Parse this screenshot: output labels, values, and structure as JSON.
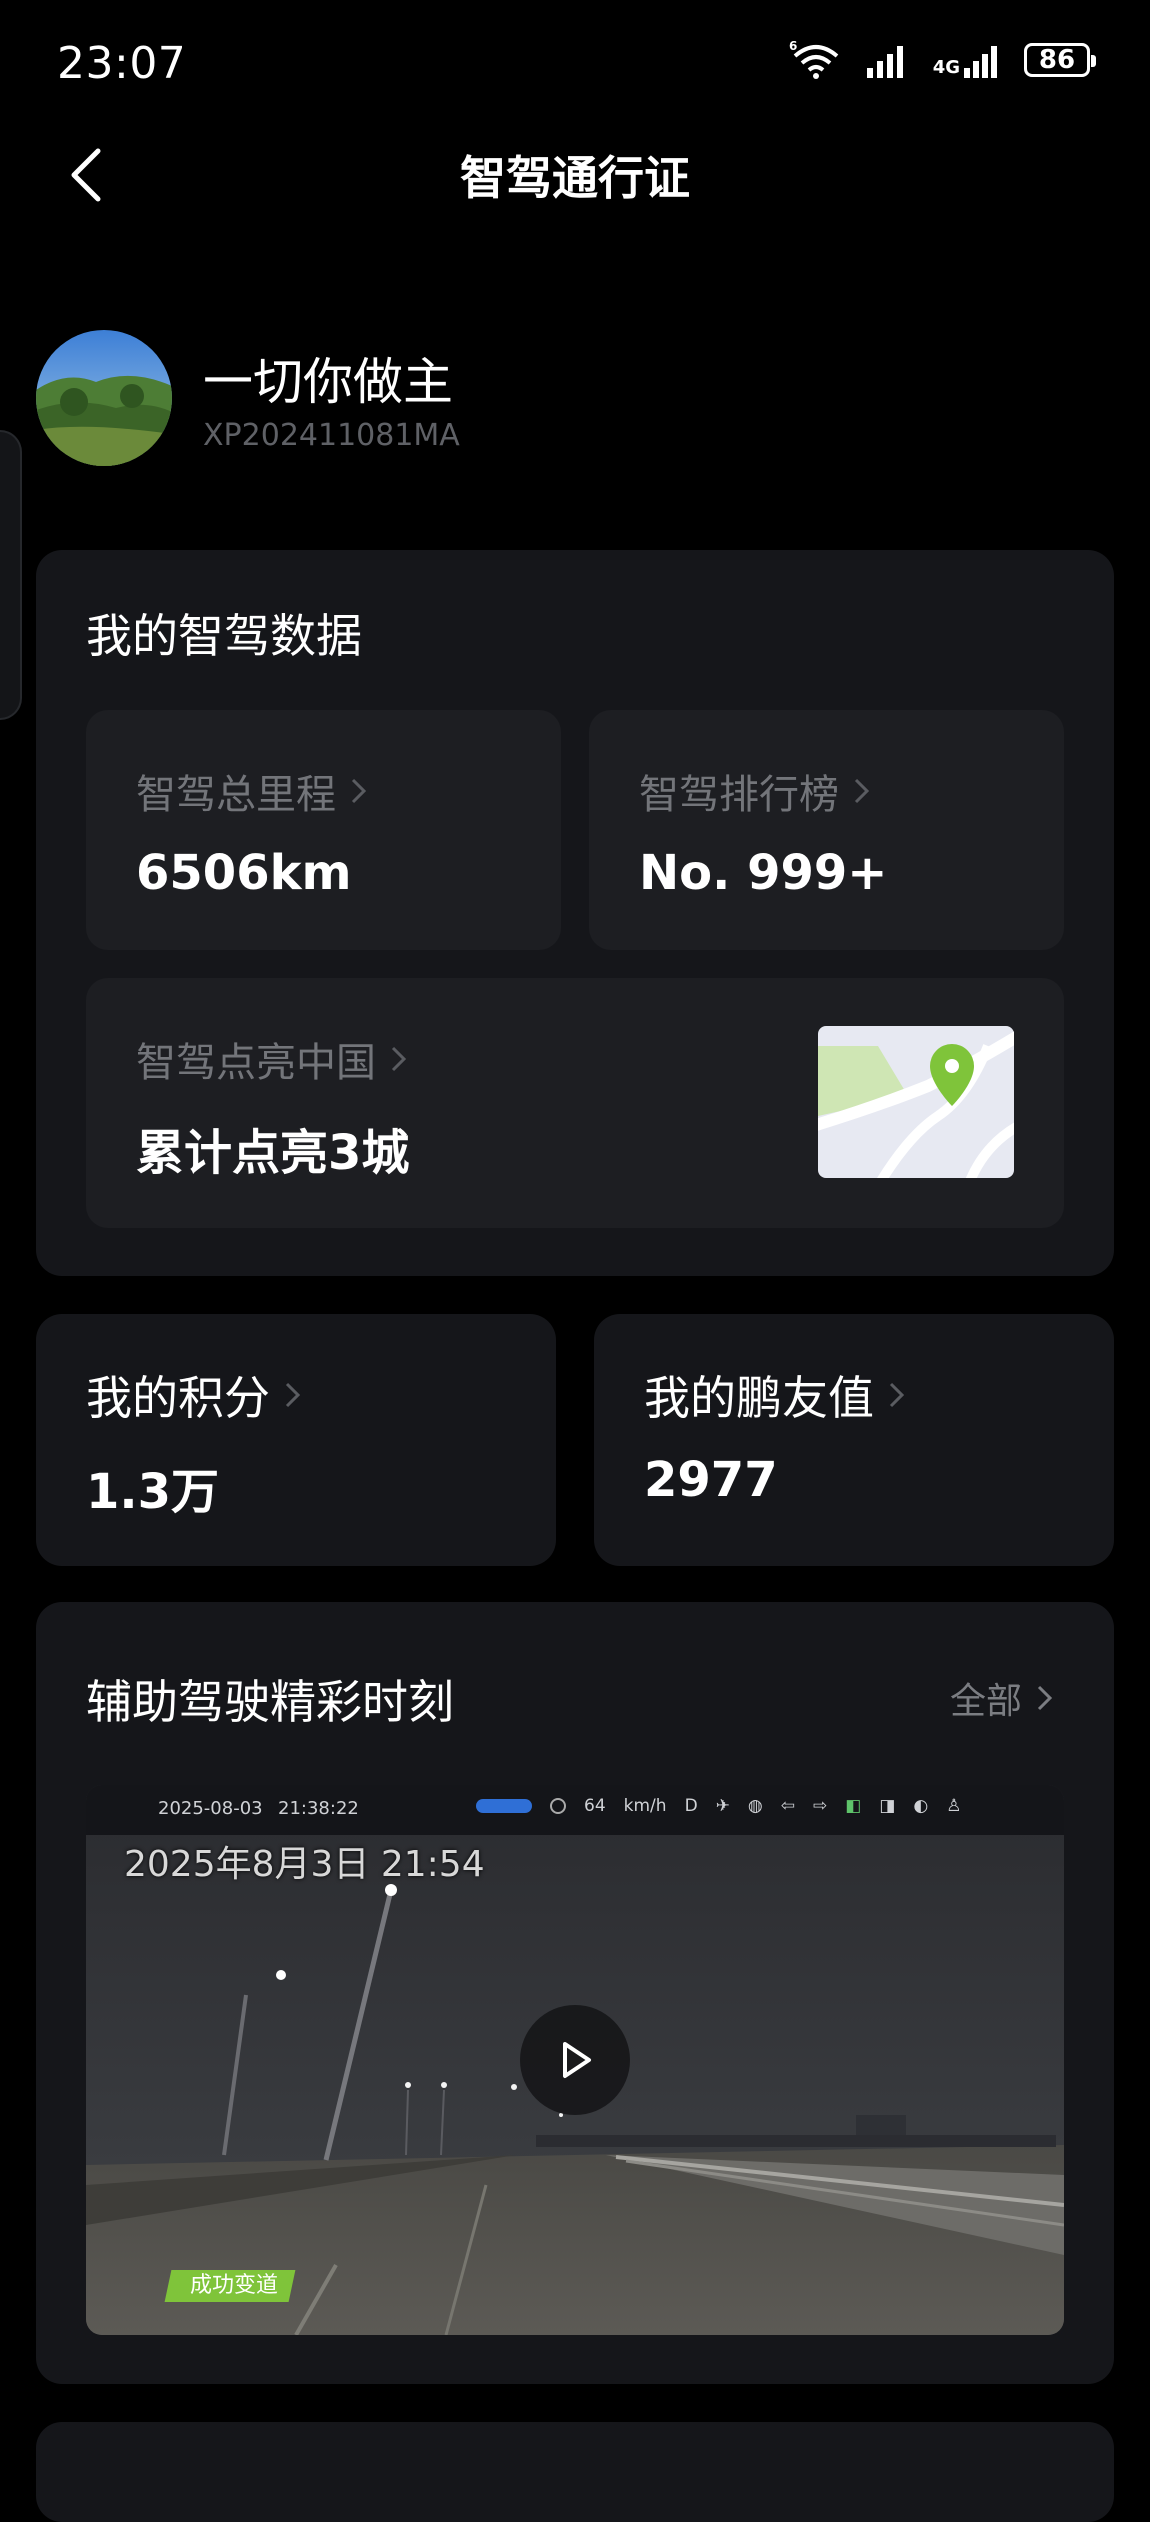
{
  "status_bar": {
    "time": "23:07",
    "wifi_badge": "6",
    "network_label": "4G",
    "battery": "86"
  },
  "header": {
    "title": "智驾通行证",
    "back_icon": "chevron-left-icon"
  },
  "profile": {
    "name": "一切你做主",
    "id": "XP202411081MA"
  },
  "driving_data": {
    "section_title": "我的智驾数据",
    "mileage": {
      "label": "智驾总里程",
      "value": "6506km"
    },
    "ranking": {
      "label": "智驾排行榜",
      "value": "No. 999+"
    },
    "light_up": {
      "label": "智驾点亮中国",
      "value": "累计点亮3城"
    }
  },
  "points": {
    "label": "我的积分",
    "value": "1.3万"
  },
  "friend_value": {
    "label": "我的鹏友值",
    "value": "2977"
  },
  "highlights": {
    "section_title": "辅助驾驶精彩时刻",
    "all_label": "全部",
    "video": {
      "hud_date": "2025-08-03",
      "hud_time": "21:38:22",
      "hud_speed": "64",
      "hud_speed_unit": "km/h",
      "hud_gear": "D",
      "timestamp": "2025年8月3日 21:54",
      "tag": "成功变道"
    }
  },
  "colors": {
    "background": "#000000",
    "card": "#15161a",
    "inner_card": "#1d1e22",
    "muted_text": "#73757a",
    "accent_green": "#7fc43a"
  }
}
